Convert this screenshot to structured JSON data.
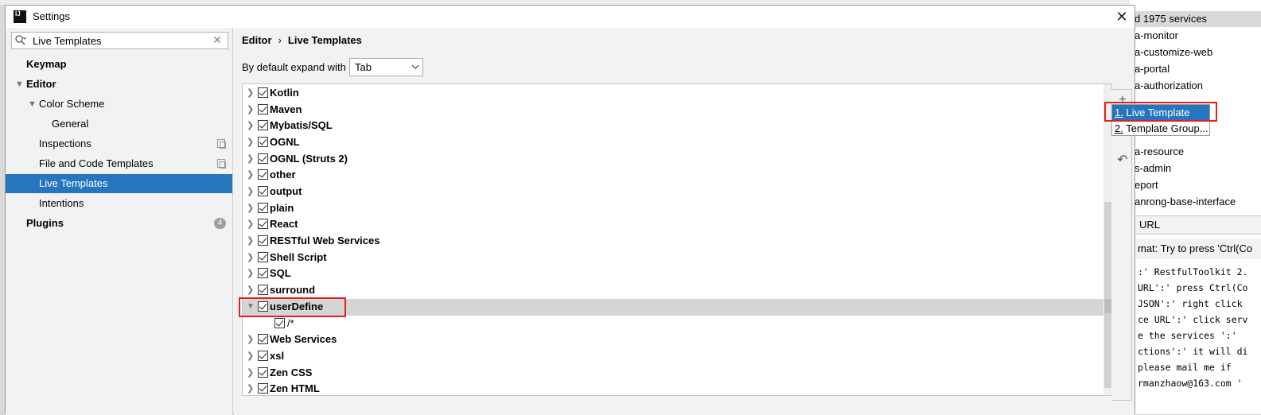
{
  "dialog": {
    "title": "Settings",
    "close_glyph": "✕"
  },
  "search": {
    "value": "Live Templates",
    "icon": "search-icon",
    "clear_glyph": "✕"
  },
  "sidebar": {
    "items": [
      {
        "label": "Keymap",
        "level": 0,
        "bold": true
      },
      {
        "label": "Editor",
        "level": 0,
        "bold": true,
        "expanded": true
      },
      {
        "label": "Color Scheme",
        "level": 1,
        "expanded": true
      },
      {
        "label": "General",
        "level": 2
      },
      {
        "label": "Inspections",
        "level": 1,
        "icon": "copy-icon"
      },
      {
        "label": "File and Code Templates",
        "level": 1,
        "icon": "copy-icon"
      },
      {
        "label": "Live Templates",
        "level": 1,
        "selected": true
      },
      {
        "label": "Intentions",
        "level": 1
      },
      {
        "label": "Plugins",
        "level": 0,
        "bold": true,
        "badge": "4"
      }
    ]
  },
  "breadcrumb": {
    "parent": "Editor",
    "sep": "›",
    "current": "Live Templates"
  },
  "expand": {
    "label": "By default expand with",
    "value": "Tab"
  },
  "groups": [
    {
      "name": "Kotlin"
    },
    {
      "name": "Maven"
    },
    {
      "name": "Mybatis/SQL"
    },
    {
      "name": "OGNL"
    },
    {
      "name": "OGNL (Struts 2)"
    },
    {
      "name": "other"
    },
    {
      "name": "output"
    },
    {
      "name": "plain"
    },
    {
      "name": "React"
    },
    {
      "name": "RESTful Web Services"
    },
    {
      "name": "Shell Script"
    },
    {
      "name": "SQL"
    },
    {
      "name": "surround"
    },
    {
      "name": "userDefine",
      "expanded": true,
      "selected": true
    },
    {
      "name": "/*",
      "child": true
    },
    {
      "name": "Web Services"
    },
    {
      "name": "xsl"
    },
    {
      "name": "Zen CSS"
    },
    {
      "name": "Zen HTML"
    }
  ],
  "tools": {
    "add": "+",
    "undo": "↶"
  },
  "popup": {
    "items": [
      {
        "num": "1.",
        "label": "Live Template",
        "active": true
      },
      {
        "num": "2.",
        "label": "Template Group..."
      }
    ]
  },
  "background": {
    "header": "d 1975 services",
    "services": [
      "a-monitor",
      "a-customize-web",
      "a-portal",
      "a-authorization",
      "a-resource",
      "s-admin",
      "eport",
      "anrong-base-interface"
    ],
    "url_label": "URL",
    "message": "mat: Try to press 'Ctrl(Co",
    "console": [
      ":' RestfulToolkit 2.",
      "URL':' press Ctrl(Co",
      " JSON':' right click",
      "ce URL':' click serv",
      "e the services ':' ",
      "ctions':' it will di",
      " please mail me if ",
      "rmanzhaow@163.com '"
    ]
  }
}
